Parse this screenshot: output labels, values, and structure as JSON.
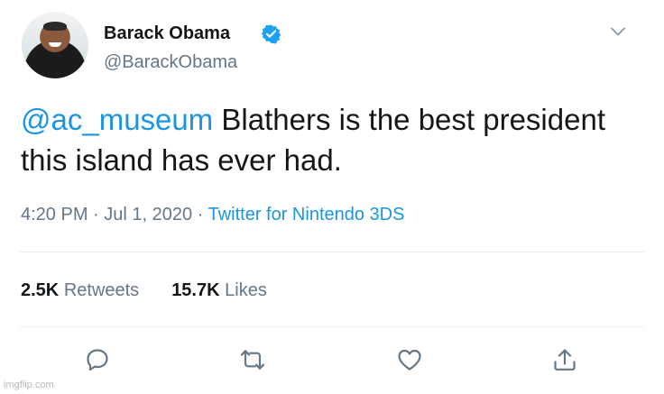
{
  "user": {
    "display_name": "Barack Obama",
    "handle": "@BarackObama",
    "verified": true
  },
  "tweet": {
    "mention": "@ac_museum",
    "text_after_mention": " Blathers is the best president this island has ever had.",
    "time": "4:20 PM",
    "separator": "·",
    "date": "Jul 1, 2020",
    "source": "Twitter for Nintendo 3DS"
  },
  "stats": {
    "retweets_count": "2.5K",
    "retweets_label": "Retweets",
    "likes_count": "15.7K",
    "likes_label": "Likes"
  },
  "actions": [
    "reply-icon",
    "retweet-icon",
    "like-icon",
    "share-icon"
  ],
  "colors": {
    "text": "#14171a",
    "secondary": "#657786",
    "link": "#1b95e0",
    "divider": "#e6ecf0"
  },
  "watermark": "imgflip.com"
}
